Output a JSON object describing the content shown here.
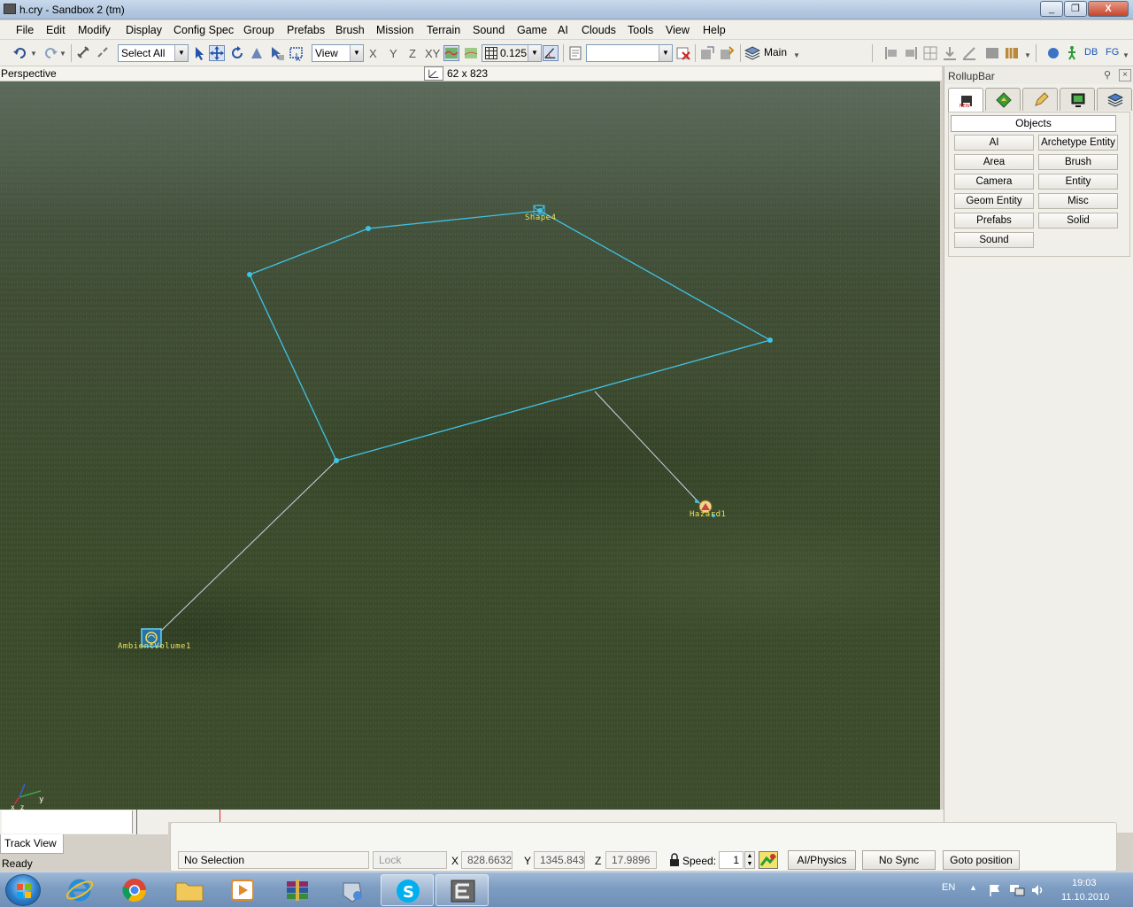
{
  "window": {
    "title": "h.cry - Sandbox 2 (tm)",
    "minimize": "_",
    "maximize": "❐",
    "close": "X"
  },
  "menu": [
    "File",
    "Edit",
    "Modify",
    "Display",
    "Config Spec",
    "Group",
    "Prefabs",
    "Brush",
    "Mission",
    "Terrain",
    "Sound",
    "Game",
    "AI",
    "Clouds",
    "Tools",
    "View",
    "Help"
  ],
  "toolbar": {
    "selection_filter": "Select All",
    "coord_system": "View",
    "axis_x": "X",
    "axis_y": "Y",
    "axis_z": "Z",
    "axis_xy": "XY",
    "grid_size": "0.125",
    "layer_name": "Main",
    "db_label": "DB",
    "fg_label": "FG"
  },
  "viewport": {
    "name": "Perspective",
    "size": "62 x 823",
    "objects": {
      "shape": "Shape4",
      "hazard": "Hazard1",
      "ambient": "AmbientVolume1"
    },
    "axis_y": "y",
    "axis_z": "x z"
  },
  "rollup": {
    "title": "RollupBar",
    "section": "Objects",
    "buttons": [
      [
        "AI",
        "Archetype Entity"
      ],
      [
        "Area",
        "Brush"
      ],
      [
        "Camera",
        "Entity"
      ],
      [
        "Geom Entity",
        "Misc"
      ],
      [
        "Prefabs",
        "Solid"
      ],
      [
        "Sound",
        ""
      ]
    ]
  },
  "bottom": {
    "track_view_tab": "Track View",
    "status": "Ready",
    "selection_status": "No Selection",
    "lock_selection": "Lock Selection",
    "x_label": "X",
    "x_value": "828.6632",
    "y_label": "Y",
    "y_value": "1345.843",
    "z_label": "Z",
    "z_value": "17.9896",
    "speed_label": "Speed:",
    "speed_value": "1",
    "ai_physics": "AI/Physics",
    "sync_player": "No Sync Player",
    "goto_position": "Goto position"
  },
  "taskbar": {
    "language": "EN",
    "time": "19:03",
    "date": "11.10.2010"
  },
  "colors": {
    "shape_line": "#3fc3e6",
    "link_line": "#c8d6e8",
    "label_yellow": "#e8e15a",
    "grass_dark": "#3a4a2b"
  }
}
